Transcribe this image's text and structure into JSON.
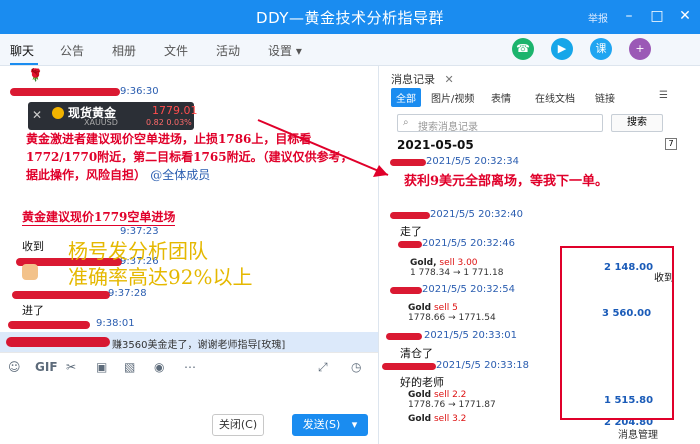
{
  "window": {
    "title": "DDY—黄金技术分析指导群",
    "report": "举报",
    "minimize": "–",
    "maximize": "□",
    "close": "✕"
  },
  "tabs": [
    "聊天",
    "公告",
    "相册",
    "文件",
    "活动",
    "设置 ▾"
  ],
  "header_icons": {
    "call": "phone-icon",
    "video": "video-icon",
    "app": "课",
    "add": "+"
  },
  "chat": {
    "rose": "🌹",
    "messages_time": [
      "9:36:30",
      "9:37:23",
      "9:37:26",
      "9:37:28",
      "9:38:01"
    ],
    "quote_card": {
      "name": "现货黄金",
      "symbol": "XAUUSD",
      "price": "1779.01",
      "change": "0.82 0.03%"
    },
    "note": "黄金激进者建议现价空单进场，止损1786上，目标看1772/1770附近，第二目标看1765附近。（建议仅供参考，据此操作，风险自担）",
    "mention": "@全体成员",
    "suggest": "黄金建议现价1779空单进场",
    "received": "收到",
    "team_line1": "杨号发分析团队",
    "team_line2": "准确率高达92%以上",
    "entered": "进了",
    "entered2": "进了",
    "notice": "赚3560美金走了，谢谢老师指导[玫瑰]"
  },
  "toolbar_icons": [
    "emoji-icon",
    "gif-icon",
    "scissors-icon",
    "folder-icon",
    "image-icon",
    "voice-icon",
    "more-icon",
    "expand-icon",
    "history-icon"
  ],
  "buttons": {
    "close": "关闭(C)",
    "send": "发送(S)",
    "send_more": "▾"
  },
  "history": {
    "title": "消息记录",
    "close": "✕",
    "tabs": [
      "全部",
      "图片/视频",
      "表情",
      "在线文档",
      "链接"
    ],
    "search_placeholder": "搜索消息记录",
    "search_button": "搜索",
    "calendar": "7",
    "date": "2021-05-05",
    "times": [
      "2021/5/5 20:32:34",
      "2021/5/5 20:32:40",
      "2021/5/5 20:32:46",
      "2021/5/5 20:32:54",
      "2021/5/5 20:33:01",
      "2021/5/5 20:33:18"
    ],
    "profit_note": "获利9美元全部离场，等我下一单。",
    "left": "走了",
    "cleared": "清仓了",
    "good_teacher": "好的老师",
    "received": "收到",
    "trades": [
      {
        "asset": "Gold,",
        "side": "sell 3.00",
        "range": "1 778.34 → 1 771.18",
        "amount": "2 148.00"
      },
      {
        "asset": "Gold",
        "side": "sell 5",
        "range": "1778.66 → 1771.54",
        "amount": "3 560.00"
      },
      {
        "asset": "Gold",
        "side": "sell 2.2",
        "range": "1778.76 → 1771.87",
        "amount": "1 515.80"
      },
      {
        "asset": "Gold",
        "side": "sell 3.2",
        "range": "",
        "amount": "2 204.80"
      }
    ],
    "status": "消息管理"
  }
}
